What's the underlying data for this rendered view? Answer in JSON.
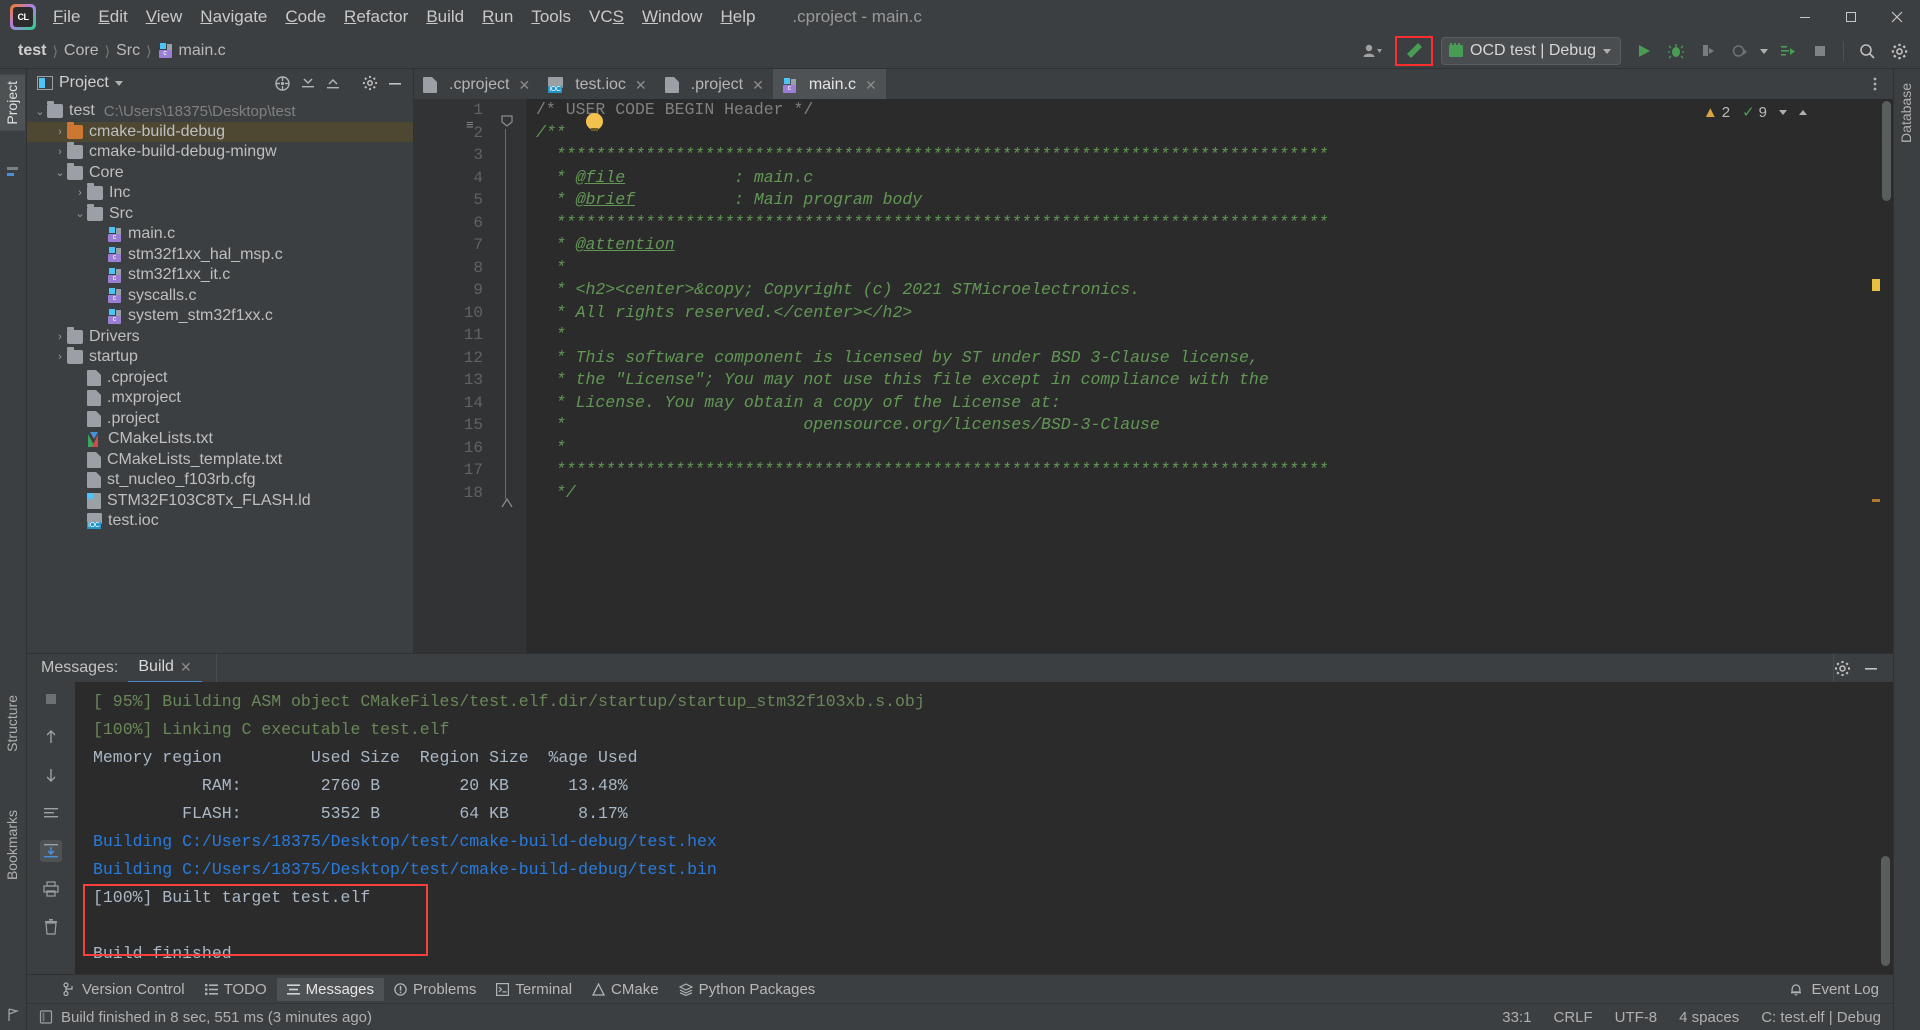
{
  "window": {
    "title": ".cproject - main.c",
    "minimize_label": "—",
    "maximize_label": "❐",
    "close_label": "✕"
  },
  "menubar": {
    "logo_text": "CL",
    "items": [
      {
        "label": "File"
      },
      {
        "label": "Edit"
      },
      {
        "label": "View"
      },
      {
        "label": "Navigate"
      },
      {
        "label": "Code"
      },
      {
        "label": "Refactor"
      },
      {
        "label": "Build"
      },
      {
        "label": "Run"
      },
      {
        "label": "Tools"
      },
      {
        "label": "VCS"
      },
      {
        "label": "Window"
      },
      {
        "label": "Help"
      }
    ]
  },
  "breadcrumb": {
    "segments": [
      "test",
      "Core",
      "Src",
      "main.c"
    ],
    "separator": "〉"
  },
  "toolbar": {
    "account_icon": "user-icon",
    "build_icon": "hammer-icon",
    "build_highlight_color": "#ff2d2d",
    "run_config": "OCD test | Debug",
    "run_icon": "play-icon",
    "debug_icon": "bug-icon",
    "attach_icon": "attach-process-icon",
    "profile_icon": "profiler-icon",
    "coverage_icon": "run-with-coverage-icon",
    "stop_icon": "stop-icon",
    "search_icon": "magnifier-icon",
    "settings_icon": "gear-icon"
  },
  "left_tool_strip": [
    {
      "label": "Project",
      "selected": true
    },
    {
      "label": "Structure",
      "selected": false
    },
    {
      "label": "Bookmarks",
      "selected": false
    }
  ],
  "right_tool_strip": [
    {
      "label": "Database",
      "selected": false
    }
  ],
  "project_panel": {
    "title": "Project",
    "actions": [
      "target-icon",
      "expand-all-icon",
      "collapse-all-icon",
      "gear-icon",
      "hide-icon"
    ],
    "tree": [
      {
        "label": "test",
        "path": "C:\\Users\\18375\\Desktop\\test",
        "depth": 0,
        "arrow": "⌄",
        "icon": "folder",
        "selected": false
      },
      {
        "label": "cmake-build-debug",
        "path": "",
        "depth": 1,
        "arrow": "›",
        "icon": "folder-orange",
        "selected": true
      },
      {
        "label": "cmake-build-debug-mingw",
        "path": "",
        "depth": 1,
        "arrow": "›",
        "icon": "folder",
        "selected": false
      },
      {
        "label": "Core",
        "path": "",
        "depth": 1,
        "arrow": "⌄",
        "icon": "folder",
        "selected": false
      },
      {
        "label": "Inc",
        "path": "",
        "depth": 2,
        "arrow": "›",
        "icon": "folder",
        "selected": false
      },
      {
        "label": "Src",
        "path": "",
        "depth": 2,
        "arrow": "⌄",
        "icon": "folder",
        "selected": false
      },
      {
        "label": "main.c",
        "path": "",
        "depth": 3,
        "arrow": "",
        "icon": "c-file",
        "selected": false
      },
      {
        "label": "stm32f1xx_hal_msp.c",
        "path": "",
        "depth": 3,
        "arrow": "",
        "icon": "c-file",
        "selected": false
      },
      {
        "label": "stm32f1xx_it.c",
        "path": "",
        "depth": 3,
        "arrow": "",
        "icon": "c-file",
        "selected": false
      },
      {
        "label": "syscalls.c",
        "path": "",
        "depth": 3,
        "arrow": "",
        "icon": "c-file",
        "selected": false
      },
      {
        "label": "system_stm32f1xx.c",
        "path": "",
        "depth": 3,
        "arrow": "",
        "icon": "c-file",
        "selected": false
      },
      {
        "label": "Drivers",
        "path": "",
        "depth": 1,
        "arrow": "›",
        "icon": "folder",
        "selected": false
      },
      {
        "label": "startup",
        "path": "",
        "depth": 1,
        "arrow": "›",
        "icon": "folder",
        "selected": false
      },
      {
        "label": ".cproject",
        "path": "",
        "depth": 2,
        "arrow": "",
        "icon": "text-file",
        "selected": false
      },
      {
        "label": ".mxproject",
        "path": "",
        "depth": 2,
        "arrow": "",
        "icon": "text-file",
        "selected": false
      },
      {
        "label": ".project",
        "path": "",
        "depth": 2,
        "arrow": "",
        "icon": "text-file",
        "selected": false
      },
      {
        "label": "CMakeLists.txt",
        "path": "",
        "depth": 2,
        "arrow": "",
        "icon": "cmake-file",
        "selected": false
      },
      {
        "label": "CMakeLists_template.txt",
        "path": "",
        "depth": 2,
        "arrow": "",
        "icon": "text-file",
        "selected": false
      },
      {
        "label": "st_nucleo_f103rb.cfg",
        "path": "",
        "depth": 2,
        "arrow": "",
        "icon": "text-file",
        "selected": false
      },
      {
        "label": "STM32F103C8Tx_FLASH.ld",
        "path": "",
        "depth": 2,
        "arrow": "",
        "icon": "ld-file",
        "selected": false
      },
      {
        "label": "test.ioc",
        "path": "",
        "depth": 2,
        "arrow": "",
        "icon": "ioc-file",
        "selected": false
      }
    ]
  },
  "editor": {
    "tabs": [
      {
        "label": ".cproject",
        "icon": "text-file",
        "active": false
      },
      {
        "label": "test.ioc",
        "icon": "ioc-file",
        "active": false
      },
      {
        "label": ".project",
        "icon": "text-file",
        "active": false
      },
      {
        "label": "main.c",
        "icon": "c-file",
        "active": true
      }
    ],
    "inspection": {
      "warning_count": "2",
      "ok_count": "9"
    },
    "lines": [
      {
        "n": "1",
        "text": "/* USER CODE BEGIN Header */",
        "style": "plain"
      },
      {
        "n": "2",
        "text": "/**",
        "style": "comment"
      },
      {
        "n": "3",
        "text": "  ******************************************************************************",
        "style": "comment"
      },
      {
        "n": "4",
        "text": "  * @file           : main.c",
        "style": "comment"
      },
      {
        "n": "5",
        "text": "  * @brief          : Main program body",
        "style": "comment"
      },
      {
        "n": "6",
        "text": "  ******************************************************************************",
        "style": "comment"
      },
      {
        "n": "7",
        "text": "  * @attention",
        "style": "comment"
      },
      {
        "n": "8",
        "text": "  *",
        "style": "comment"
      },
      {
        "n": "9",
        "text": "  * <h2><center>&copy; Copyright (c) 2021 STMicroelectronics.",
        "style": "comment"
      },
      {
        "n": "10",
        "text": "  * All rights reserved.</center></h2>",
        "style": "comment"
      },
      {
        "n": "11",
        "text": "  *",
        "style": "comment"
      },
      {
        "n": "12",
        "text": "  * This software component is licensed by ST under BSD 3-Clause license,",
        "style": "comment"
      },
      {
        "n": "13",
        "text": "  * the \"License\"; You may not use this file except in compliance with the",
        "style": "comment"
      },
      {
        "n": "14",
        "text": "  * License. You may obtain a copy of the License at:",
        "style": "comment"
      },
      {
        "n": "15",
        "text": "  *                        opensource.org/licenses/BSD-3-Clause",
        "style": "comment"
      },
      {
        "n": "16",
        "text": "  *",
        "style": "comment"
      },
      {
        "n": "17",
        "text": "  ******************************************************************************",
        "style": "comment"
      },
      {
        "n": "18",
        "text": "  */",
        "style": "comment"
      }
    ]
  },
  "build_panel": {
    "messages_label": "Messages:",
    "tab_label": "Build",
    "tab_close": "✕",
    "actions": [
      "gear-icon",
      "hide-icon"
    ],
    "side_icons": [
      "stop-icon",
      "up-arrow-icon",
      "down-arrow-icon",
      "soft-wrap-icon",
      "scroll-to-end-icon",
      "print-icon",
      "trash-icon"
    ],
    "log": [
      {
        "text": "[ 95%] Building ASM object CMakeFiles/test.elf.dir/startup/startup_stm32f103xb.s.obj",
        "color": "green"
      },
      {
        "text": "[100%] Linking C executable test.elf",
        "color": "green"
      },
      {
        "text": "Memory region         Used Size  Region Size  %age Used",
        "color": "plain"
      },
      {
        "text": "           RAM:        2760 B        20 KB      13.48%",
        "color": "plain"
      },
      {
        "text": "         FLASH:        5352 B        64 KB       8.17%",
        "color": "plain"
      },
      {
        "text": "Building C:/Users/18375/Desktop/test/cmake-build-debug/test.hex",
        "color": "blue"
      },
      {
        "text": "Building C:/Users/18375/Desktop/test/cmake-build-debug/test.bin",
        "color": "blue"
      },
      {
        "text": "[100%] Built target test.elf",
        "color": "plain"
      },
      {
        "text": "",
        "color": "plain"
      },
      {
        "text": "Build finished",
        "color": "plain"
      }
    ],
    "highlight_color": "#fa3f3f"
  },
  "tool_window_bar": {
    "items": [
      {
        "label": "Version Control",
        "icon": "branch-icon",
        "selected": false
      },
      {
        "label": "TODO",
        "icon": "list-icon",
        "selected": false
      },
      {
        "label": "Messages",
        "icon": "messages-icon",
        "selected": true
      },
      {
        "label": "Problems",
        "icon": "warning-circle-icon",
        "selected": false
      },
      {
        "label": "Terminal",
        "icon": "terminal-icon",
        "selected": false
      },
      {
        "label": "CMake",
        "icon": "cmake-icon",
        "selected": false
      },
      {
        "label": "Python Packages",
        "icon": "layers-icon",
        "selected": false
      }
    ],
    "right": {
      "label": "Event Log",
      "icon": "bell-icon"
    }
  },
  "status_bar": {
    "message": "Build finished in 8 sec, 551 ms (3 minutes ago)",
    "caret": "33:1",
    "line_sep": "CRLF",
    "encoding": "UTF-8",
    "indent": "4 spaces",
    "config": "C: test.elf | Debug"
  }
}
